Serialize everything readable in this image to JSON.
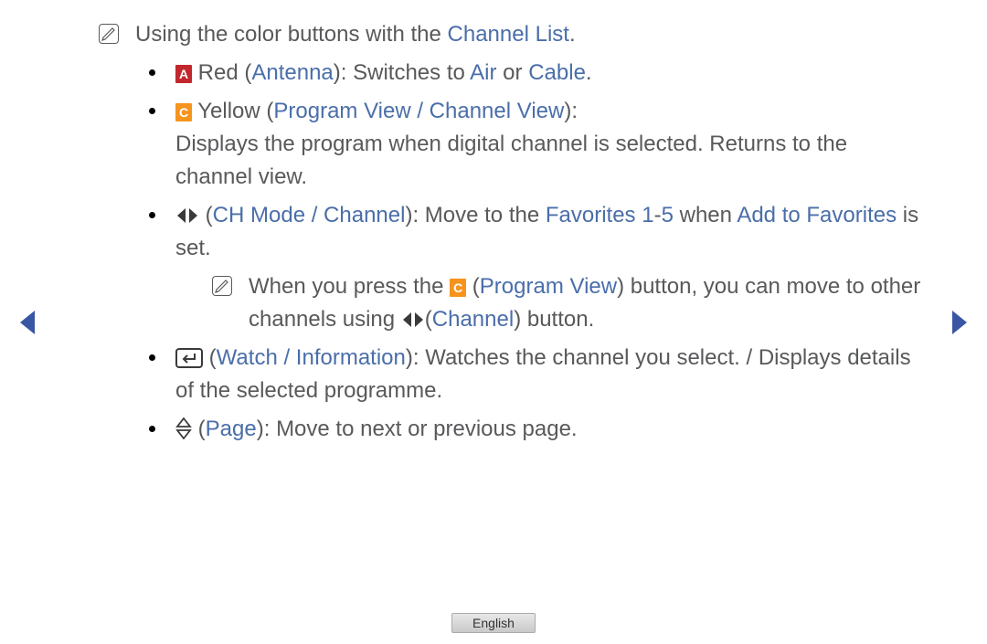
{
  "intro": {
    "prefix": "Using the color buttons with the ",
    "link": "Channel List",
    "suffix": "."
  },
  "items": {
    "red": {
      "letter": "A",
      "label_pre": " Red (",
      "antenna": "Antenna",
      "mid": "): Switches to ",
      "air": "Air",
      "or": " or ",
      "cable": "Cable",
      "end": "."
    },
    "yellow": {
      "letter": "C",
      "label_pre": " Yellow (",
      "pv": "Program View / Channel View",
      "end": "):",
      "desc": "Displays the program when digital channel is selected. Returns to the channel view."
    },
    "chmode": {
      "open": " (",
      "cm": "CH Mode / Channel",
      "mid1": "): Move to the ",
      "fav": "Favorites 1",
      "dash": "-",
      "five": "5",
      "when": " when ",
      "atf": "Add to Favorites",
      "end": " is set."
    },
    "subnote": {
      "pre": "When you press the ",
      "letter": "C",
      "open": " (",
      "pv": "Program View",
      "mid": ") button, you can move to other channels using ",
      "ch_open": "(",
      "ch": "Channel",
      "close": ") button."
    },
    "watch": {
      "open": " (",
      "wi": "Watch / Information",
      "rest": "): Watches the channel you select. / Displays details of the selected programme."
    },
    "page": {
      "open": " (",
      "pg": "Page",
      "rest": "): Move to next or previous page."
    }
  },
  "footer": {
    "lang": "English"
  }
}
